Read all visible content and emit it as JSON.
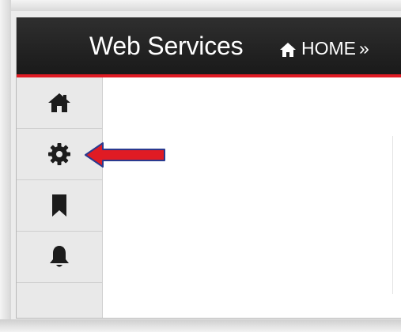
{
  "header": {
    "app_title": "Web Services",
    "breadcrumb_home": "HOME",
    "breadcrumb_separator": "»"
  },
  "sidebar": {
    "items": [
      {
        "name": "home",
        "icon": "home-icon"
      },
      {
        "name": "settings",
        "icon": "gear-icon"
      },
      {
        "name": "bookmarks",
        "icon": "bookmark-icon"
      },
      {
        "name": "notifications",
        "icon": "bell-icon"
      }
    ]
  },
  "annotation": {
    "arrow_color": "#e01b24",
    "arrow_outline": "#2a3a8f",
    "points_to": "settings"
  },
  "colors": {
    "topbar": "#222222",
    "accent": "#e01b24",
    "sidebar": "#e9e9e9"
  }
}
